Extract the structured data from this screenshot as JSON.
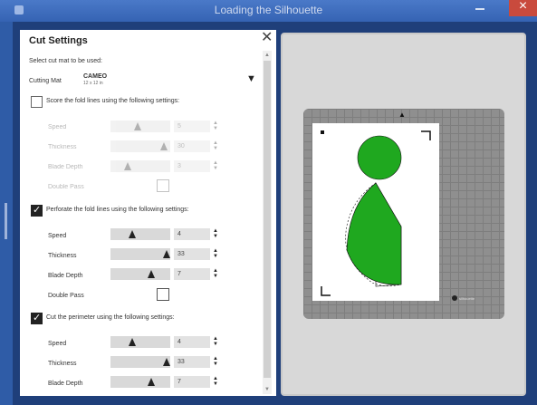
{
  "window": {
    "title": "Loading the Silhouette"
  },
  "panel": {
    "title": "Cut Settings",
    "select_mat_label": "Select cut mat to be used:",
    "mat": {
      "label": "Cutting Mat",
      "name": "CAMEO",
      "size": "12 x 12 in"
    }
  },
  "sections": [
    {
      "title": "Score the fold lines using the following settings:",
      "checked": false,
      "rows": [
        {
          "label": "Speed",
          "value": "5",
          "level": 0.45
        },
        {
          "label": "Thickness",
          "value": "30",
          "level": 0.95
        },
        {
          "label": "Blade Depth",
          "value": "3",
          "level": 0.25
        }
      ],
      "double_pass_label": "Double Pass"
    },
    {
      "title": "Perforate the fold lines using the following settings:",
      "checked": true,
      "rows": [
        {
          "label": "Speed",
          "value": "4",
          "level": 0.35
        },
        {
          "label": "Thickness",
          "value": "33",
          "level": 1.0
        },
        {
          "label": "Blade Depth",
          "value": "7",
          "level": 0.7
        }
      ],
      "double_pass_label": "Double Pass"
    },
    {
      "title": "Cut the perimeter using the following settings:",
      "checked": true,
      "rows": [
        {
          "label": "Speed",
          "value": "4",
          "level": 0.35
        },
        {
          "label": "Thickness",
          "value": "33",
          "level": 1.0
        },
        {
          "label": "Blade Depth",
          "value": "7",
          "level": 0.7
        }
      ]
    }
  ],
  "preview": {
    "shape_color": "#1fa81f",
    "brand_text": "silhouette"
  }
}
